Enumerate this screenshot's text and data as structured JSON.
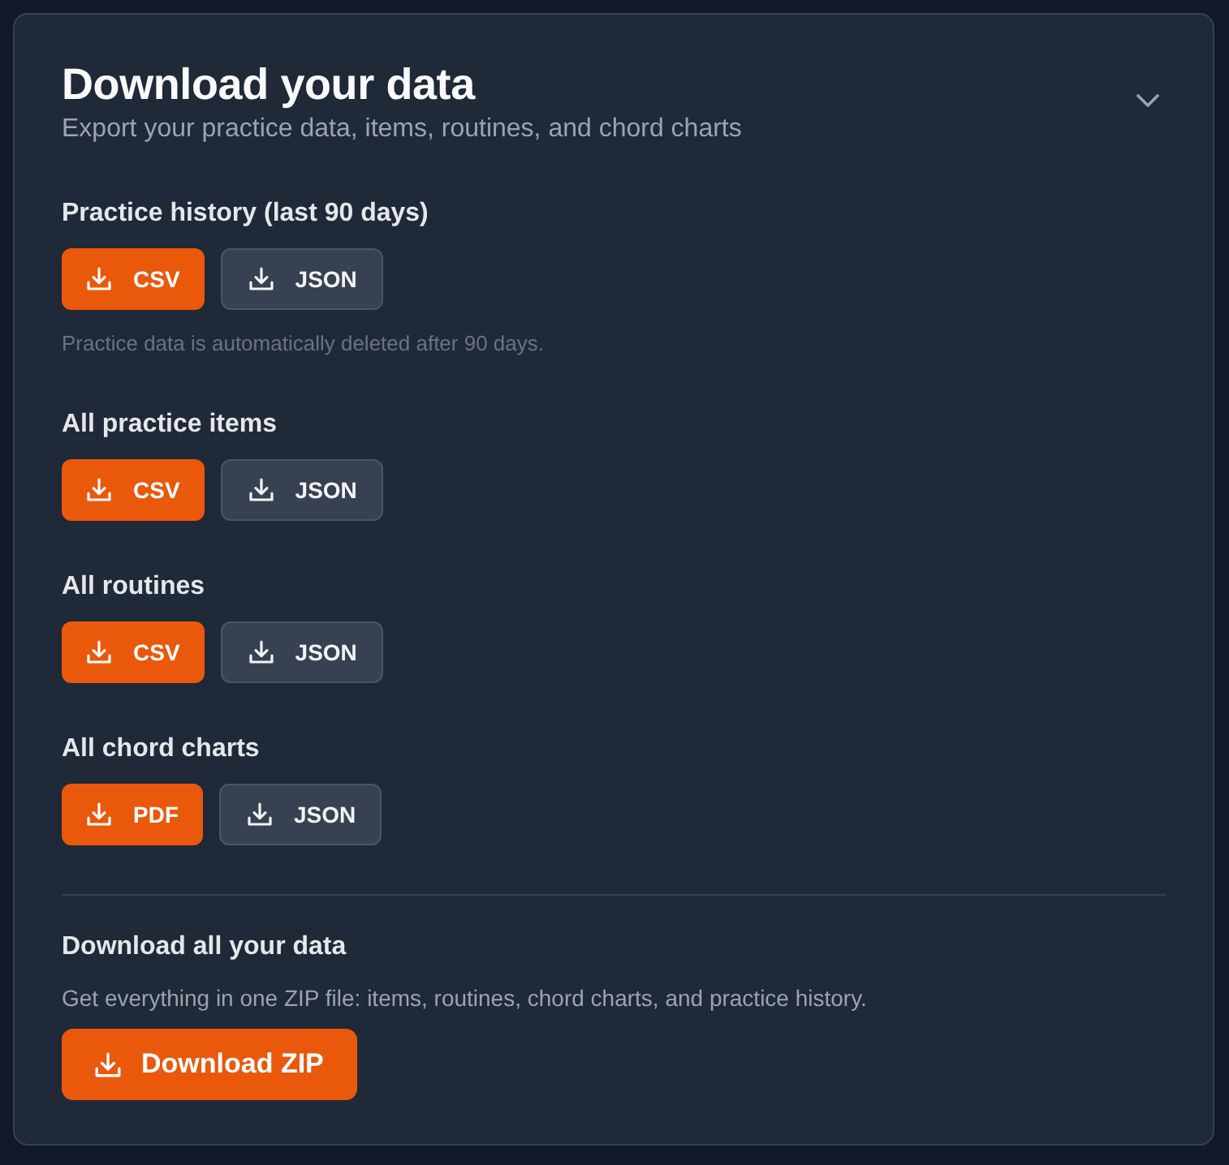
{
  "card": {
    "title": "Download your data",
    "subtitle": "Export your practice data, items, routines, and chord charts"
  },
  "sections": [
    {
      "heading": "Practice history (last 90 days)",
      "buttons": [
        {
          "label": "CSV",
          "kind": "primary"
        },
        {
          "label": "JSON",
          "kind": "secondary"
        }
      ],
      "note": "Practice data is automatically deleted after 90 days."
    },
    {
      "heading": "All practice items",
      "buttons": [
        {
          "label": "CSV",
          "kind": "primary"
        },
        {
          "label": "JSON",
          "kind": "secondary"
        }
      ]
    },
    {
      "heading": "All routines",
      "buttons": [
        {
          "label": "CSV",
          "kind": "primary"
        },
        {
          "label": "JSON",
          "kind": "secondary"
        }
      ]
    },
    {
      "heading": "All chord charts",
      "buttons": [
        {
          "label": "PDF",
          "kind": "primary"
        },
        {
          "label": "JSON",
          "kind": "secondary"
        }
      ]
    }
  ],
  "download_all": {
    "heading": "Download all your data",
    "description": "Get everything in one ZIP file: items, routines, chord charts, and practice history.",
    "button": {
      "label": "Download ZIP",
      "kind": "primary"
    }
  }
}
